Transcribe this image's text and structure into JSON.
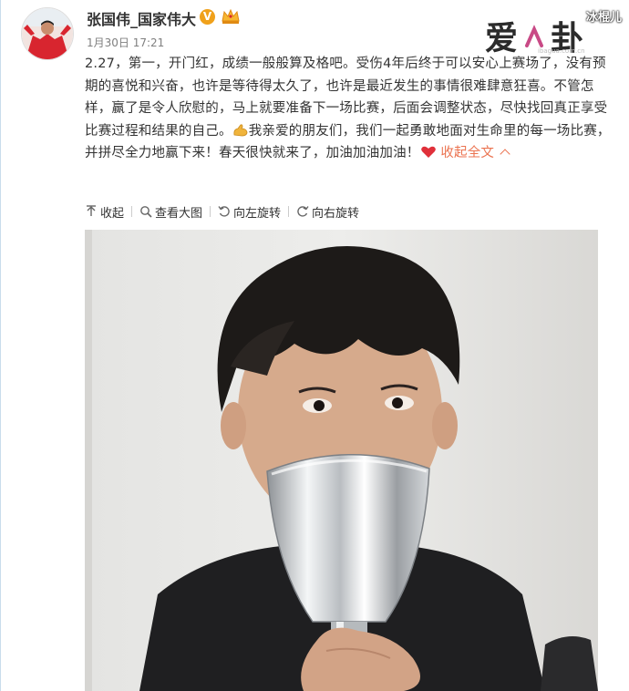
{
  "post": {
    "username": "张国伟_国家伟大",
    "verified_badge": "V",
    "timestamp": "1月30日 17:21",
    "text_main": "2.27，第一，开门红，成绩一般般算及格吧。受伤4年后终于可以安心上赛场了，没有预期的喜悦和兴奋，也许是等待得太久了，也许是最近发生的事情很难肆意狂喜。不管怎样，赢了是令人欣慰的，马上就要准备下一场比赛，后面会调整状态，尽快找回真正享受比赛过程和结果的自己。",
    "text_after_emoji": "我亲爱的朋友们，我们一起勇敢地面对生命里的每一场比赛，并拼尽全力地赢下来！春天很快就来了，加油加油加油！",
    "collapse_label": "收起全文",
    "inline_emoji_1": "flexed-arm-emoji",
    "inline_emoji_2": "red-heart-emoji"
  },
  "toolbar": {
    "collapse": "收起",
    "view_large": "查看大图",
    "rotate_left": "向左旋转",
    "rotate_right": "向右旋转"
  },
  "watermark": {
    "logo_text": "爱八卦",
    "name": "冰棍儿",
    "site": "ibagua.com.cn"
  },
  "colors": {
    "accent": "#eb7350",
    "badge": "#f0a11b",
    "text": "#333333",
    "muted": "#808080"
  }
}
